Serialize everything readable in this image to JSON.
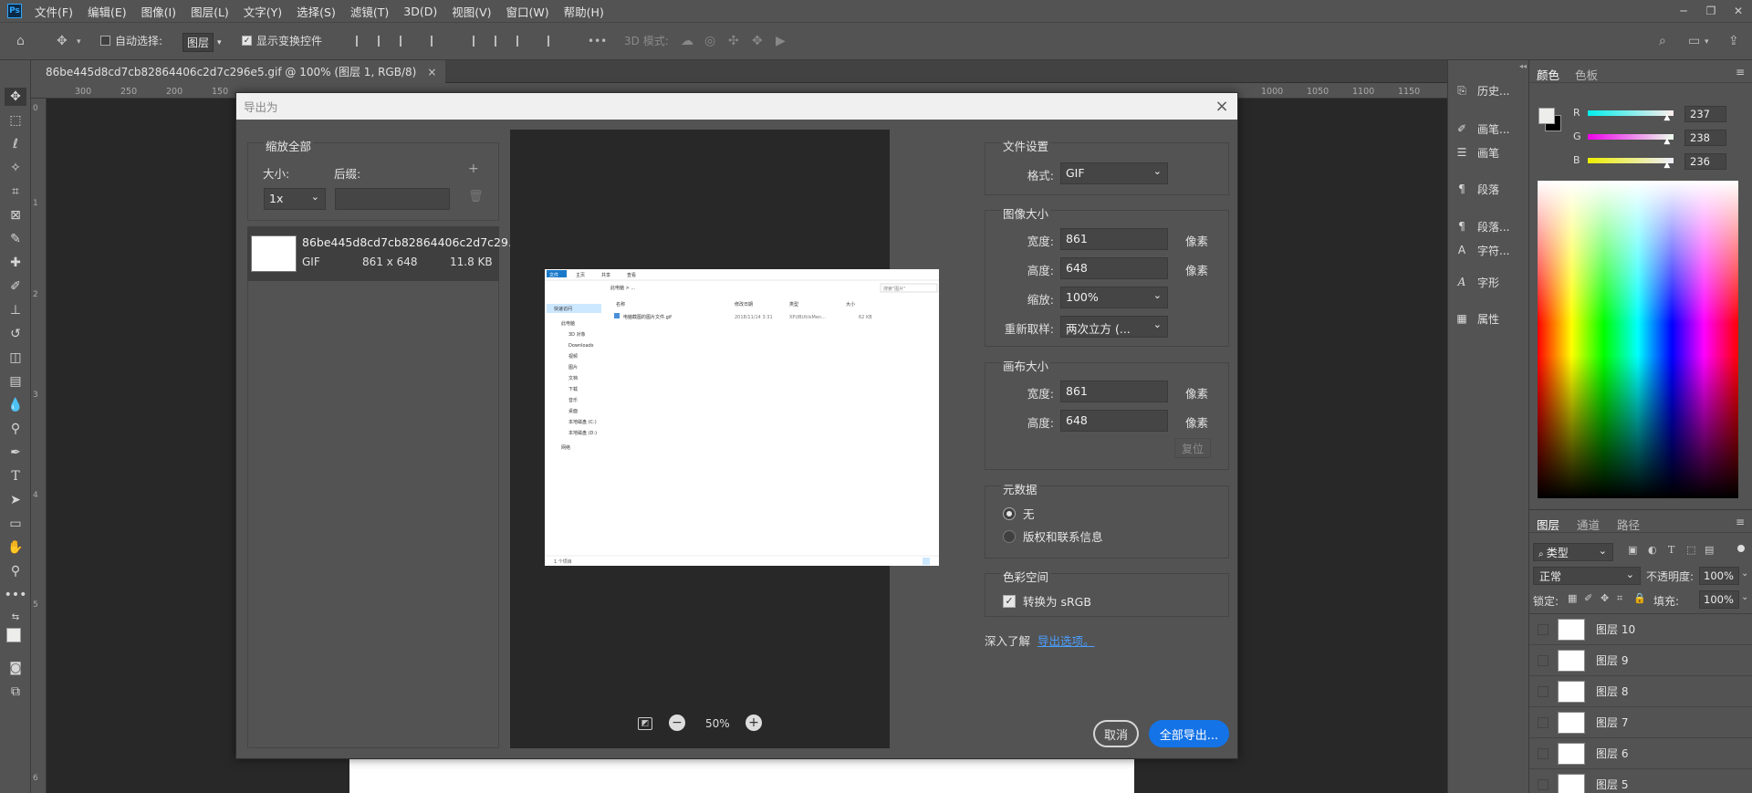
{
  "app": {
    "logo": "Ps"
  },
  "menu": [
    "文件(F)",
    "编辑(E)",
    "图像(I)",
    "图层(L)",
    "文字(Y)",
    "选择(S)",
    "滤镜(T)",
    "3D(D)",
    "视图(V)",
    "窗口(W)",
    "帮助(H)"
  ],
  "options": {
    "auto_select_label": "自动选择:",
    "auto_select_value": "图层",
    "show_transform_label": "显示变换控件",
    "mode_3d_label": "3D 模式:",
    "more": "•••"
  },
  "document": {
    "tab_title": "86be445d8cd7cb82864406c2d7c296e5.gif @ 100% (图层 1, RGB/8)",
    "close": "×"
  },
  "ruler": {
    "h_ticks": [
      "300",
      "250",
      "200",
      "150",
      "1000",
      "1050",
      "1100",
      "1150"
    ],
    "v_ticks": [
      "0",
      "1",
      "2",
      "3",
      "4",
      "5",
      "6"
    ]
  },
  "dialog": {
    "title": "导出为",
    "close": "×",
    "scale_all": {
      "title": "缩放全部",
      "size_label": "大小:",
      "suffix_label": "后缀:",
      "size_value": "1x",
      "suffix_value": "",
      "add": "+"
    },
    "asset": {
      "name": "86be445d8cd7cb82864406c2d7c29...",
      "format": "GIF",
      "dimensions": "861 x 648",
      "filesize": "11.8 KB"
    },
    "zoom": {
      "value": "50%"
    },
    "file_settings": {
      "title": "文件设置",
      "format_label": "格式:",
      "format_value": "GIF"
    },
    "image_size": {
      "title": "图像大小",
      "width_label": "宽度:",
      "width_value": "861",
      "height_label": "高度:",
      "height_value": "648",
      "scale_label": "缩放:",
      "scale_value": "100%",
      "resample_label": "重新取样:",
      "resample_value": "两次立方 (...",
      "unit": "像素"
    },
    "canvas_size": {
      "title": "画布大小",
      "width_label": "宽度:",
      "width_value": "861",
      "height_label": "高度:",
      "height_value": "648",
      "unit": "像素",
      "reset": "复位"
    },
    "metadata": {
      "title": "元数据",
      "options": [
        "无",
        "版权和联系信息"
      ],
      "selected": "无"
    },
    "color_space": {
      "title": "色彩空间",
      "convert_label": "转换为 sRGB",
      "checked": true
    },
    "learn_more_label": "深入了解",
    "learn_more_link": "导出选项。",
    "cancel": "取消",
    "export_all": "全部导出..."
  },
  "preview_explorer": {
    "tabs": [
      "文件",
      "主页",
      "共享",
      "查看"
    ],
    "path": "此电脑 > ...",
    "search": "搜索\"图片\"",
    "columns": [
      "名称",
      "修改日期",
      "类型",
      "大小"
    ],
    "file_name": "电脑截图的图片文件.gif",
    "file_date": "2018/11/14 3:31",
    "file_type": "XPUBUtilsMen...",
    "file_size": "62 KB",
    "sidebar": [
      "快速访问",
      "此电脑",
      "3D 对象",
      "Downloads",
      "视频",
      "图片",
      "文档",
      "下载",
      "音乐",
      "桌面",
      "本地磁盘 (C:)",
      "本地磁盘 (D:)",
      "网络"
    ],
    "status": "1 个项目"
  },
  "icon_column": [
    {
      "icon": "history-icon",
      "label": "历史..."
    },
    {
      "icon": "brush-icon",
      "label": "画笔..."
    },
    {
      "icon": "brush-settings-icon",
      "label": "画笔"
    },
    {
      "icon": "paragraph-icon",
      "label": "段落"
    },
    {
      "icon": "paragraph-style-icon",
      "label": "段落..."
    },
    {
      "icon": "character-icon",
      "label": "字符..."
    },
    {
      "icon": "glyph-icon",
      "label": "字形"
    },
    {
      "icon": "properties-icon",
      "label": "属性"
    }
  ],
  "color_panel": {
    "tabs": [
      "颜色",
      "色板"
    ],
    "r_label": "R",
    "r_value": "237",
    "g_label": "G",
    "g_value": "238",
    "b_label": "B",
    "b_value": "236",
    "r_level": 0.93,
    "g_level": 0.93,
    "b_level": 0.93,
    "fg_color": "#edeeec",
    "bg_color": "#000000"
  },
  "layers_panel": {
    "tabs": [
      "图层",
      "通道",
      "路径"
    ],
    "filter_value": "类型",
    "blend_mode": "正常",
    "opacity_label": "不透明度:",
    "opacity_value": "100%",
    "lock_label": "锁定:",
    "fill_label": "填充:",
    "fill_value": "100%",
    "layers": [
      "图层 10",
      "图层 9",
      "图层 8",
      "图层 7",
      "图层 6",
      "图层 5"
    ]
  },
  "colors": {
    "accent": "#1473e6",
    "ui_gray": "#535353",
    "dark": "#282828"
  }
}
